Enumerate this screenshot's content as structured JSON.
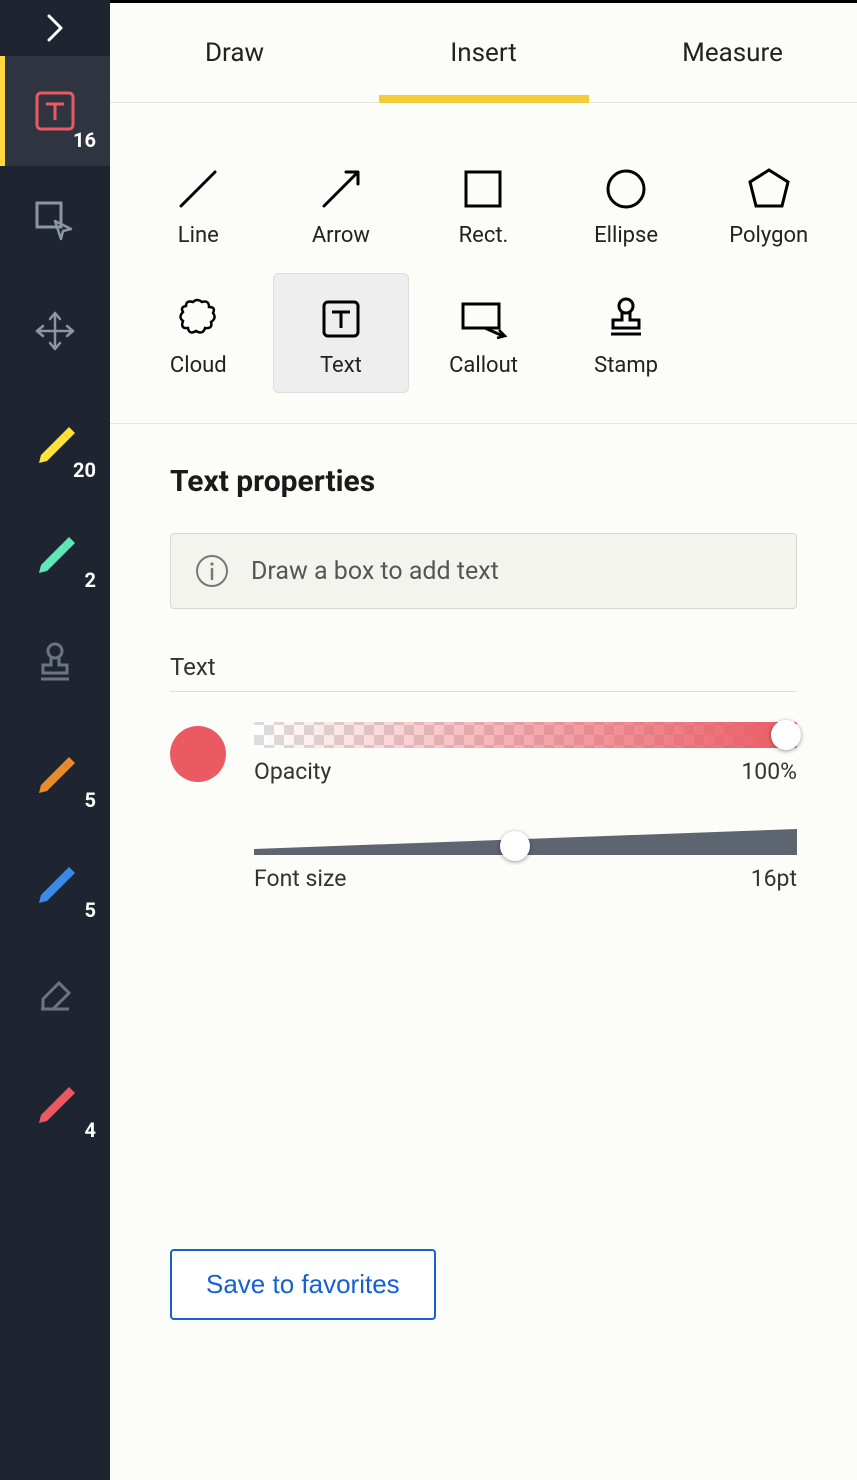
{
  "sidebar": {
    "items": [
      {
        "name": "text-tool",
        "badge": "16",
        "active": true
      },
      {
        "name": "select-tool",
        "badge": ""
      },
      {
        "name": "move-tool",
        "badge": ""
      },
      {
        "name": "pen-yellow",
        "badge": "20"
      },
      {
        "name": "pen-teal",
        "badge": "2"
      },
      {
        "name": "stamp-tool",
        "badge": ""
      },
      {
        "name": "pen-orange",
        "badge": "5"
      },
      {
        "name": "pen-blue",
        "badge": "5"
      },
      {
        "name": "eraser-tool",
        "badge": ""
      },
      {
        "name": "pen-red",
        "badge": "4"
      }
    ]
  },
  "tabs": [
    {
      "id": "draw",
      "label": "Draw",
      "active": false
    },
    {
      "id": "insert",
      "label": "Insert",
      "active": true
    },
    {
      "id": "measure",
      "label": "Measure",
      "active": false
    }
  ],
  "shapes": [
    {
      "id": "line",
      "label": "Line"
    },
    {
      "id": "arrow",
      "label": "Arrow"
    },
    {
      "id": "rect",
      "label": "Rect."
    },
    {
      "id": "ellipse",
      "label": "Ellipse"
    },
    {
      "id": "polygon",
      "label": "Polygon"
    },
    {
      "id": "cloud",
      "label": "Cloud"
    },
    {
      "id": "text",
      "label": "Text",
      "selected": true
    },
    {
      "id": "callout",
      "label": "Callout"
    },
    {
      "id": "stamp",
      "label": "Stamp"
    }
  ],
  "properties": {
    "title": "Text properties",
    "hint": "Draw a box to add text",
    "section": "Text",
    "color": "#eb5a63",
    "opacity": {
      "label": "Opacity",
      "value": "100%",
      "percent": 100
    },
    "fontsize": {
      "label": "Font size",
      "value": "16pt",
      "percent": 48
    }
  },
  "save_label": "Save to favorites"
}
